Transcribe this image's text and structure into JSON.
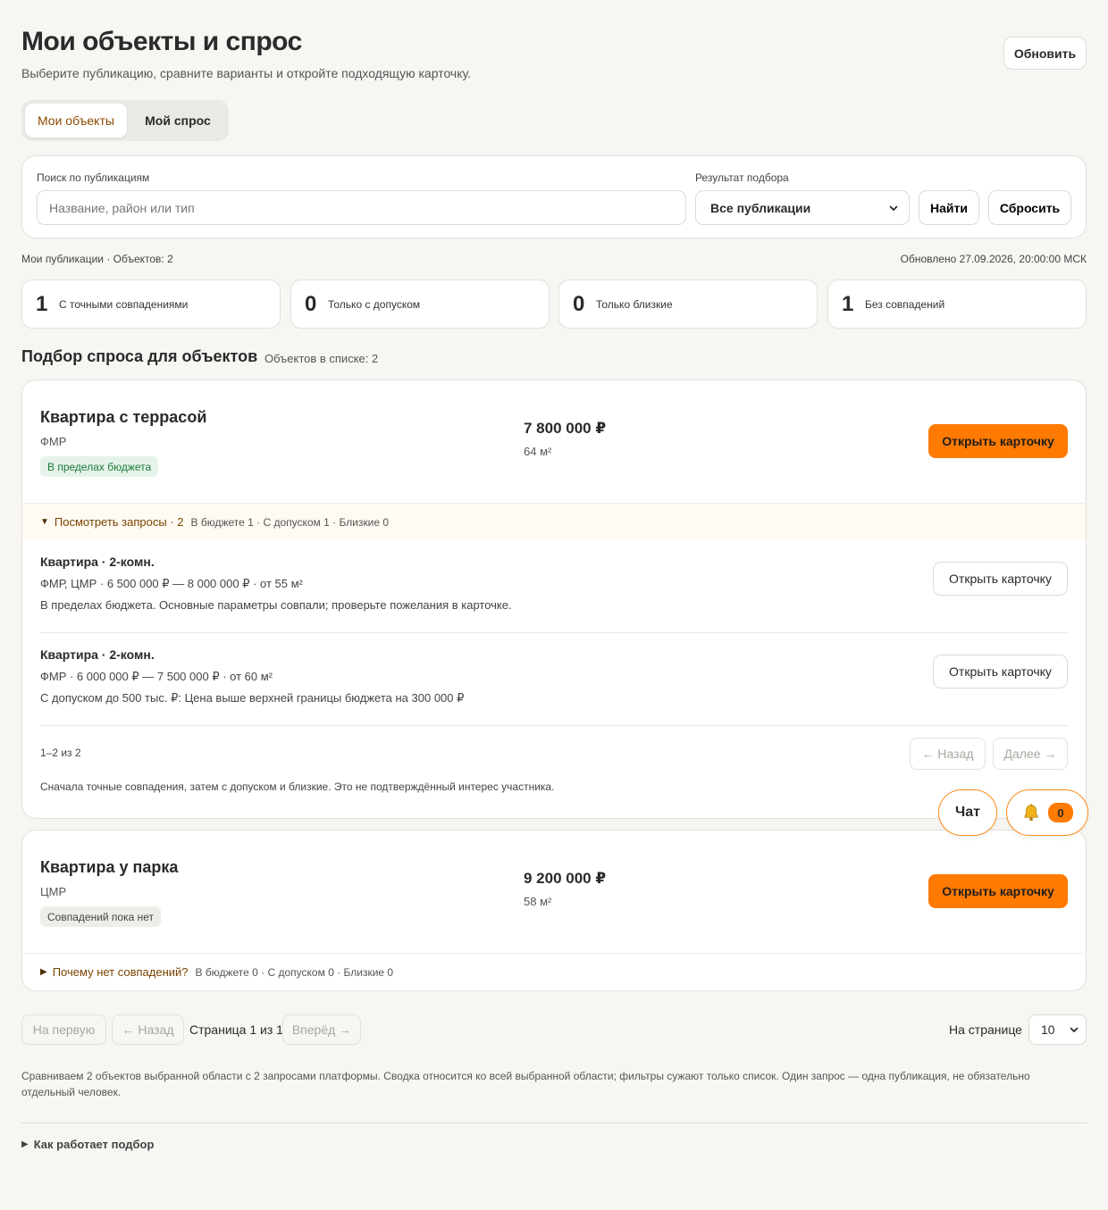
{
  "header": {
    "title": "Мои объекты и спрос",
    "subtitle": "Выберите публикацию, сравните варианты и откройте подходящую карточку.",
    "refresh_label": "Обновить"
  },
  "tabs": [
    {
      "label": "Мои объекты",
      "active": true
    },
    {
      "label": "Мой спрос",
      "active": false
    }
  ],
  "filters": {
    "search_label": "Поиск по публикациям",
    "search_placeholder": "Название, район или тип",
    "search_value": "",
    "result_label": "Результат подбора",
    "result_selected": "Все публикации",
    "find_label": "Найти",
    "reset_label": "Сбросить"
  },
  "meta": {
    "left": "Мои публикации · Объектов: 2",
    "right": "Обновлено 27.09.2026, 20:00:00 МСК"
  },
  "stats": [
    {
      "value": "1",
      "label": "С точными совпадениями"
    },
    {
      "value": "0",
      "label": "Только с допуском"
    },
    {
      "value": "0",
      "label": "Только близкие"
    },
    {
      "value": "1",
      "label": "Без совпадений"
    }
  ],
  "section": {
    "title": "Подбор спроса для объектов",
    "count": "Объектов в списке: 2"
  },
  "objects": [
    {
      "title": "Квартира с террасой",
      "district": "ФМР",
      "badge": "В пределах бюджета",
      "price": "7 800 000 ₽",
      "area": "64 м²",
      "open_label": "Открыть карточку",
      "summary_toggle": "Посмотреть запросы · 2",
      "summary_stats": "В бюджете 1 · С допуском 1 · Близкие 0",
      "requests": [
        {
          "title": "Квартира · 2-комн.",
          "params": "ФМР, ЦМР · 6 500 000 ₽ — 8 000 000 ₽ · от 55 м²",
          "note": "В пределах бюджета. Основные параметры совпали; проверьте пожелания в карточке.",
          "open_label": "Открыть карточку"
        },
        {
          "title": "Квартира · 2-комн.",
          "params": "ФМР · 6 000 000 ₽ — 7 500 000 ₽ · от 60 м²",
          "note": "С допуском до 500 тыс. ₽: Цена выше верхней границы бюджета на 300 000 ₽",
          "open_label": "Открыть карточку"
        }
      ],
      "pager_range": "1–2 из 2",
      "back_label": "← Назад",
      "next_label": "Далее →",
      "note": "Сначала точные совпадения, затем с допуском и близкие. Это не подтверждённый интерес участника."
    },
    {
      "title": "Квартира у парка",
      "district": "ЦМР",
      "badge": "Совпадений пока нет",
      "price": "9 200 000 ₽",
      "area": "58 м²",
      "open_label": "Открыть карточку",
      "summary_toggle": "Почему нет совпадений?",
      "summary_stats": "В бюджете 0 · С допуском 0 · Близкие 0"
    }
  ],
  "floating": {
    "chat_label": "Чат",
    "bell_icon": "bell-icon",
    "notification_count": "0"
  },
  "pager": {
    "first_label": "На первую",
    "back_label": "← Назад",
    "page_text": "Страница 1 из 1",
    "forward_label": "Вперёд →",
    "per_page_label": "На странице",
    "per_page_value": "10"
  },
  "footnote": "Сравниваем 2 объектов выбранной области с 2 запросами платформы. Сводка относится ко всей выбранной области; фильтры сужают только список. Один запрос — одна публикация, не обязательно отдельный человек.",
  "how_it_works_label": "Как работает подбор",
  "colors": {
    "accent": "#ff7a00",
    "background": "#f7f6f3",
    "badge_green_bg": "#e5f3ea",
    "badge_green_text": "#1e7a3c"
  }
}
